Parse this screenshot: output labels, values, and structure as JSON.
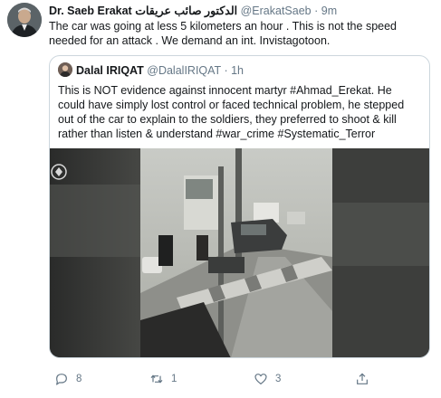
{
  "tweet": {
    "author_name": "Dr. Saeb Erakat",
    "author_name_ar": "الدكتور صائب عريقات",
    "handle": "@ErakatSaeb",
    "separator": "·",
    "time": "9m",
    "text": "The car was going at less 5 kilometers an hour . This is not the speed needed for an attack . We demand an int. Invistagotoon."
  },
  "quoted": {
    "author_name": "Dalal IRIQAT",
    "handle": "@DalalIRIQAT",
    "separator": "·",
    "time": "1h",
    "text": "This is NOT evidence against innocent martyr #Ahmad_Erekat. He could have simply lost control or faced technical problem, he stepped out of the car to explain to the soldiers, they preferred to shoot & kill rather than listen & understand #war_crime #Systematic_Terror"
  },
  "actions": {
    "reply_icon": "reply-icon",
    "reply_count": "8",
    "retweet_icon": "retweet-icon",
    "retweet_count": "1",
    "like_icon": "heart-icon",
    "like_count": "3",
    "share_icon": "share-icon"
  },
  "colors": {
    "text": "#14171a",
    "secondary": "#657786",
    "border": "#ccd6dd"
  }
}
